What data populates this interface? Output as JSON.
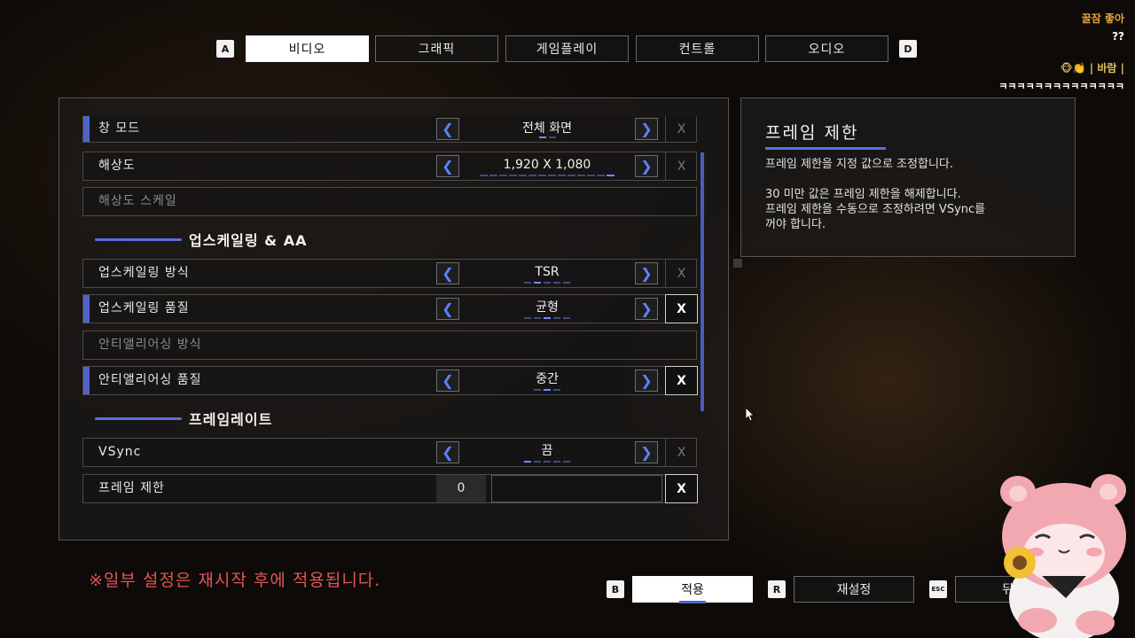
{
  "tabs": {
    "left_key": "A",
    "right_key": "D",
    "items": [
      "비디오",
      "그래픽",
      "게임플레이",
      "컨트롤",
      "오디오"
    ],
    "active": "비디오"
  },
  "settings": {
    "window_mode": {
      "label": "창 모드",
      "value": "전체 화면",
      "x": "X"
    },
    "resolution": {
      "label": "해상도",
      "value": "1,920 X 1,080",
      "x": "X"
    },
    "resolution_scale": {
      "label": "해상도 스케일"
    },
    "section_upscaling": "업스케일링 & AA",
    "upscaling_method": {
      "label": "업스케일링 방식",
      "value": "TSR",
      "x": "X"
    },
    "upscaling_quality": {
      "label": "업스케일링 품질",
      "value": "균형",
      "x": "X"
    },
    "aa_method": {
      "label": "안티앨리어싱 방식"
    },
    "aa_quality": {
      "label": "안티앨리어싱 품질",
      "value": "중간",
      "x": "X"
    },
    "section_framerate": "프레임레이트",
    "vsync": {
      "label": "VSync",
      "value": "끔",
      "x": "X"
    },
    "frame_limit": {
      "label": "프레임 제한",
      "value": "0",
      "x": "X"
    }
  },
  "info": {
    "title": "프레임 제한",
    "line1": "프레임 제한을 지정 값으로 조정합니다.",
    "line2": "30 미만 값은 프레임 제한을 해제합니다.",
    "line3": "프레임 제한을 수동으로 조정하려면 VSync를",
    "line4": "꺼야 합니다."
  },
  "notice": "※일부 설정은 재시작 후에 적용됩니다.",
  "bottom": {
    "apply_key": "B",
    "apply": "적용",
    "reset_key": "R",
    "reset": "재설정",
    "back_key": "ESC",
    "back": "뒤"
  },
  "chat": {
    "user1": "꿀잠 좋아",
    "msg1": "??",
    "user2": "🐵👏 | 바람 |",
    "msg2": "ㅋㅋㅋㅋㅋㅋㅋㅋㅋㅋㅋㅋㅋㅋ"
  },
  "colors": {
    "accent": "#5064c8",
    "notice": "#e05555",
    "arrow": "#5d82ff"
  }
}
